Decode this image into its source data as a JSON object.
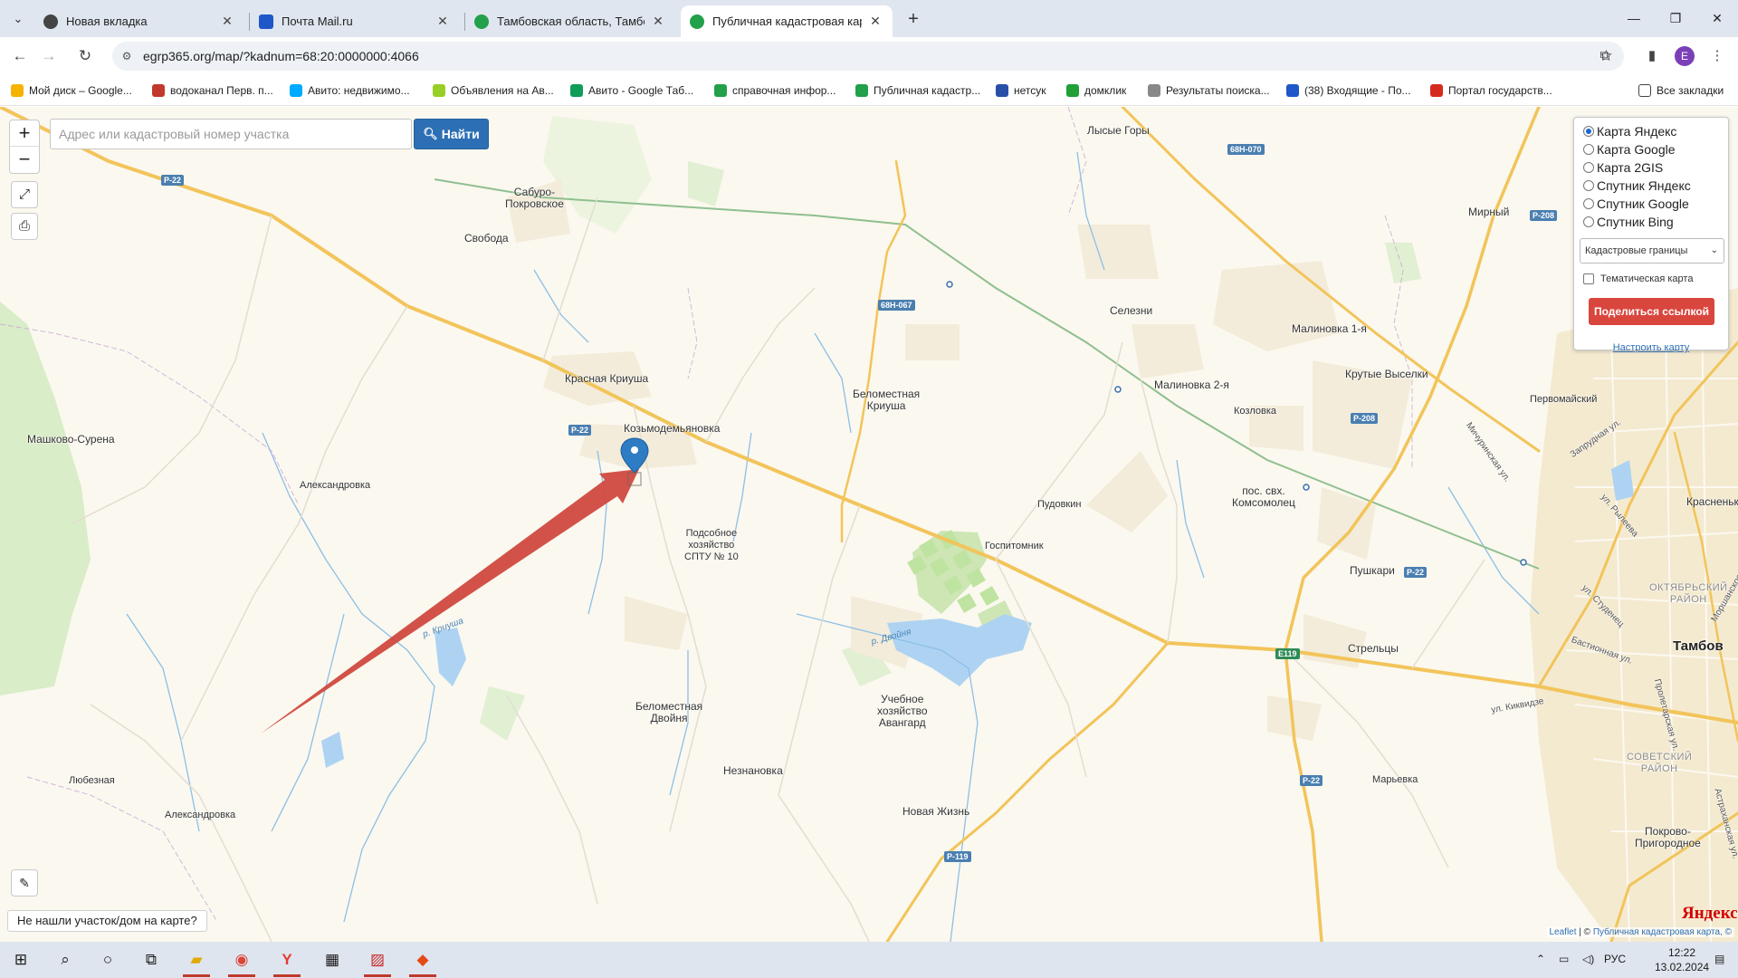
{
  "browser": {
    "tabs": [
      {
        "title": "Новая вкладка",
        "active": false,
        "favicon_color": "#444444"
      },
      {
        "title": "Почта Mail.ru",
        "active": false,
        "favicon_color": "#1e57c8"
      },
      {
        "title": "Тамбовская область, Тамбовс",
        "active": false,
        "favicon_color": "#22a04a"
      },
      {
        "title": "Публичная кадастровая карта",
        "active": true,
        "favicon_color": "#22a04a"
      }
    ],
    "new_tab_label": "+",
    "url": "egrp365.org/map/?kadnum=68:20:0000000:4066",
    "profile_initial": "E",
    "bookmarks": [
      {
        "label": "Мой диск – Google...",
        "icon_color": "#f4b400"
      },
      {
        "label": "водоканал Перв. п...",
        "icon_color": "#c0392b"
      },
      {
        "label": "Авито: недвижимо...",
        "icon_color": "#00aaff"
      },
      {
        "label": "Объявления на Ав...",
        "icon_color": "#97cf26"
      },
      {
        "label": "Авито - Google Таб...",
        "icon_color": "#0f9d58"
      },
      {
        "label": "справочная инфор...",
        "icon_color": "#22a04a"
      },
      {
        "label": "Публичная кадастр...",
        "icon_color": "#22a04a"
      },
      {
        "label": "нетсук",
        "icon_color": "#2a4fa8"
      },
      {
        "label": "домклик",
        "icon_color": "#21a038"
      },
      {
        "label": "Результаты поиска...",
        "icon_color": "#888888"
      },
      {
        "label": "(38) Входящие - По...",
        "icon_color": "#1e57c8"
      },
      {
        "label": "Портал государств...",
        "icon_color": "#d52b1e"
      }
    ],
    "all_bookmarks_label": "Все закладки"
  },
  "map": {
    "search": {
      "placeholder": "Адрес или кадастровый номер участка",
      "value": "",
      "button_label": "Найти"
    },
    "zoom_in_label": "+",
    "zoom_out_label": "−",
    "layers": {
      "options": [
        {
          "label": "Карта Яндекс",
          "selected": true
        },
        {
          "label": "Карта Google",
          "selected": false
        },
        {
          "label": "Карта 2GIS",
          "selected": false
        },
        {
          "label": "Спутник Яндекс",
          "selected": false
        },
        {
          "label": "Спутник Google",
          "selected": false
        },
        {
          "label": "Спутник Bing",
          "selected": false
        }
      ],
      "overlay_select": "Кадастровые границы",
      "thematic_label": "Тематическая карта",
      "thematic_checked": false,
      "share_label": "Поделиться ссылкой",
      "setup_label": "Настроить карту"
    },
    "not_found_label": "Не нашли участок/дом на карте?",
    "attribution": {
      "leaflet": "Leaflet",
      "separator": " | © ",
      "source": "Публичная кадастровая карта, ©"
    },
    "provider_logo": "Яндекс",
    "places": [
      {
        "name": "Лысые Горы"
      },
      {
        "name": "Сабуро-\nПокровское"
      },
      {
        "name": "Свобода"
      },
      {
        "name": "Мирный"
      },
      {
        "name": "Селезни"
      },
      {
        "name": "Малиновка 1-я"
      },
      {
        "name": "Малиновка 2-я"
      },
      {
        "name": "Красная Криуша"
      },
      {
        "name": "Беломестная\nКриуша"
      },
      {
        "name": "Крутые Выселки"
      },
      {
        "name": "Козловка"
      },
      {
        "name": "Первомайский"
      },
      {
        "name": "Козьмодемьяновка"
      },
      {
        "name": "Машково-Сурена"
      },
      {
        "name": "Александровка"
      },
      {
        "name": "Пудовкин"
      },
      {
        "name": "пос. свх.\nКомсомолец"
      },
      {
        "name": "Красненькое"
      },
      {
        "name": "Подсобное\nхозяйство\nСПТУ № 10"
      },
      {
        "name": "Госпитомник"
      },
      {
        "name": "Пушкари"
      },
      {
        "name": "Стрельцы"
      },
      {
        "name": "Тамбов"
      },
      {
        "name": "Учебное\nхозяйство\nАвангард"
      },
      {
        "name": "Беломестная\nДвойня"
      },
      {
        "name": "Незнановка"
      },
      {
        "name": "Марьевка"
      },
      {
        "name": "Покрово-\nПригородное"
      },
      {
        "name": "Любезная"
      },
      {
        "name": "Александровка"
      },
      {
        "name": "Новая Жизнь"
      }
    ],
    "districts": [
      "Октябрьский\nрайон",
      "Советский\nрайон"
    ],
    "streets": [
      "ул. Киквидзе",
      "Мичуринская ул.",
      "Бастионная ул.",
      "Пролетарская ул.",
      "Астраханская ул.",
      "Запрудная ул.",
      "ул. Рылеева",
      "ул. Студенец",
      "Моршанское ш."
    ],
    "rivers": [
      "р. Криуша",
      "р. Двойня"
    ],
    "road_shields": [
      "Р-22",
      "Р-22",
      "Р-22",
      "68Н-070",
      "68Н-067",
      "Р-208",
      "Р-208",
      "E119",
      "Р-22",
      "Р-119"
    ]
  },
  "taskbar": {
    "language": "РУС",
    "time": "12:22",
    "date": "13.02.2024"
  },
  "colors": {
    "map_background": "#fbf8ef",
    "forest": "#d9edc8",
    "water": "#aed3f2",
    "major_road": "#f2c45a",
    "railway": "#8fbf8f",
    "city": "#f4ead0",
    "pin": "#2d7cc4",
    "arrow": "#d0493f",
    "find_button": "#2d6fb4",
    "share_button": "#d9463e"
  }
}
